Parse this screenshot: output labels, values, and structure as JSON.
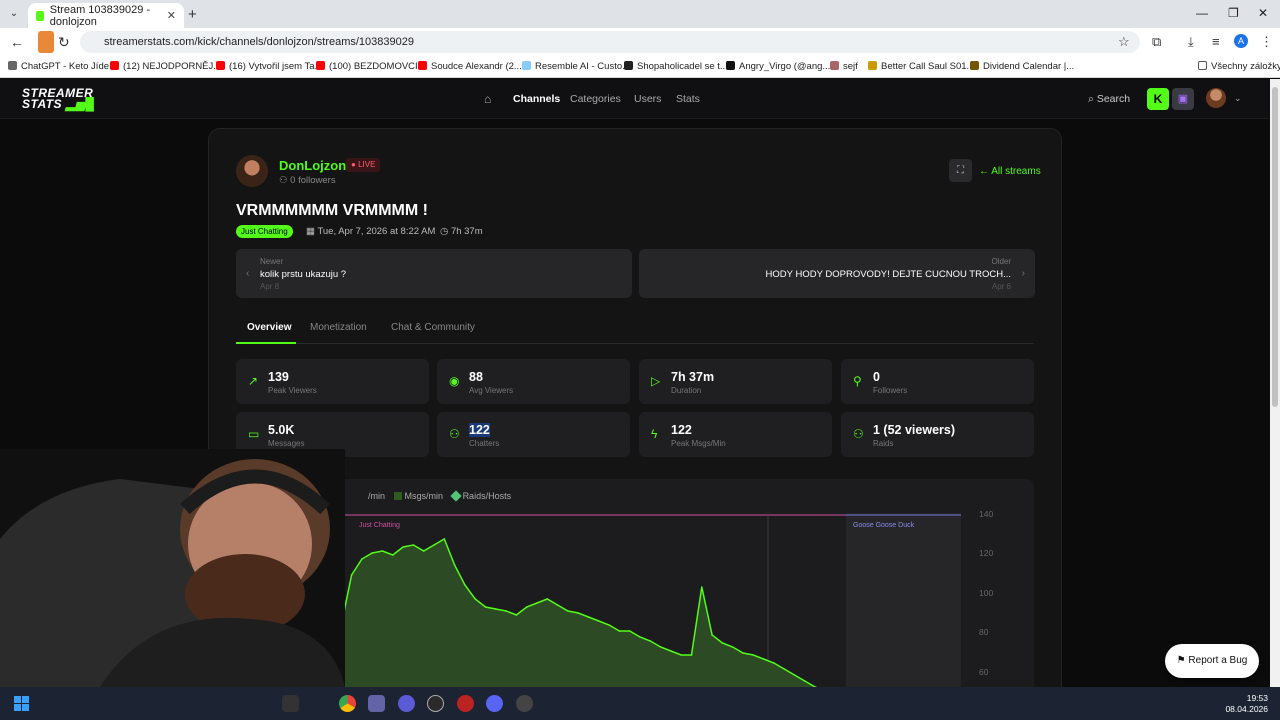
{
  "browser": {
    "tab_title": "Stream 103839029 - donlojzon",
    "url": "streamerstats.com/kick/channels/donlojzon/streams/103839029",
    "profile_initial": "A",
    "bookmarks": [
      "ChatGPT - Keto Jíde...",
      "(12) NEJODPORNĚJ...",
      "(16) Vytvořil jsem Ta...",
      "(100) BEZDOMOVCI...",
      "Soudce Alexandr (2...",
      "Resemble AI - Custo...",
      "Shopaholicadel se t...",
      "Angry_Virgo (@ang...",
      "sejf",
      "Better Call Saul S01...",
      "Dividend Calendar |..."
    ],
    "all_bookmarks": "Všechny záložky"
  },
  "site": {
    "logo_top": "STREAMER",
    "logo_bottom": "STATS",
    "nav": [
      "Channels",
      "Categories",
      "Users",
      "Stats"
    ],
    "search_label": "Search"
  },
  "channel": {
    "name": "DonLojzon",
    "live": "LIVE",
    "followers": "0 followers",
    "all_streams": "All streams"
  },
  "stream": {
    "title": "VRMMMMMM VRMMMM !",
    "category": "Just Chatting",
    "date": "Tue, Apr 7, 2026 at 8:22 AM",
    "duration": "7h 37m",
    "newer": {
      "label": "Newer",
      "title": "kolik prstu ukazuju ?",
      "date": "Apr 8"
    },
    "older": {
      "label": "Older",
      "title": "HODY HODY DOPROVODY! DEJTE CUCNOU TROCH...",
      "date": "Apr 6"
    }
  },
  "tabs": [
    "Overview",
    "Monetization",
    "Chat & Community"
  ],
  "stats": [
    {
      "value": "139",
      "label": "Peak Viewers",
      "icon": "trending-up-icon"
    },
    {
      "value": "88",
      "label": "Avg Viewers",
      "icon": "eye-icon"
    },
    {
      "value": "7h 37m",
      "label": "Duration",
      "icon": "play-icon"
    },
    {
      "value": "0",
      "label": "Followers",
      "icon": "user-plus-icon"
    },
    {
      "value": "5.0K",
      "label": "Messages",
      "icon": "message-icon"
    },
    {
      "value": "122",
      "label": "Chatters",
      "icon": "users-icon"
    },
    {
      "value": "122",
      "label": "Peak Msgs/Min",
      "icon": "bolt-icon"
    },
    {
      "value": "1 (52 viewers)",
      "label": "Raids",
      "icon": "users-raid-icon"
    }
  ],
  "chart": {
    "legend": [
      "/min",
      "Msgs/min",
      "Raids/Hosts"
    ],
    "segments": [
      "Just Chatting",
      "Goose Goose Duck"
    ],
    "y_ticks": [
      "140",
      "120",
      "100",
      "80",
      "60"
    ]
  },
  "chart_data": {
    "type": "area",
    "series": [
      {
        "name": "Viewers",
        "x": [
          0,
          2,
          4,
          6,
          8,
          10,
          12,
          14,
          16,
          18,
          20,
          22,
          24,
          26,
          28,
          30,
          32,
          34,
          36,
          38,
          40,
          42,
          44,
          46,
          48,
          50,
          52,
          54,
          56,
          58,
          60,
          62,
          64,
          66,
          68,
          70,
          72,
          74,
          76,
          78,
          80,
          82,
          84,
          86,
          88,
          90,
          92,
          94,
          96,
          98,
          100
        ],
        "y": [
          55,
          85,
          110,
          118,
          121,
          122,
          120,
          124,
          125,
          122,
          125,
          128,
          115,
          105,
          98,
          94,
          93,
          92,
          90,
          94,
          96,
          98,
          95,
          92,
          91,
          89,
          87,
          85,
          82,
          82,
          79,
          77,
          74,
          72,
          70,
          70,
          104,
          80,
          76,
          74,
          71,
          70,
          68,
          66,
          63,
          60,
          57,
          54,
          52,
          50,
          48
        ]
      }
    ],
    "ylim": [
      60,
      140
    ]
  },
  "report_bug": "Report a Bug",
  "taskbar": {
    "time": "19:53",
    "date": "08.04.2026"
  }
}
